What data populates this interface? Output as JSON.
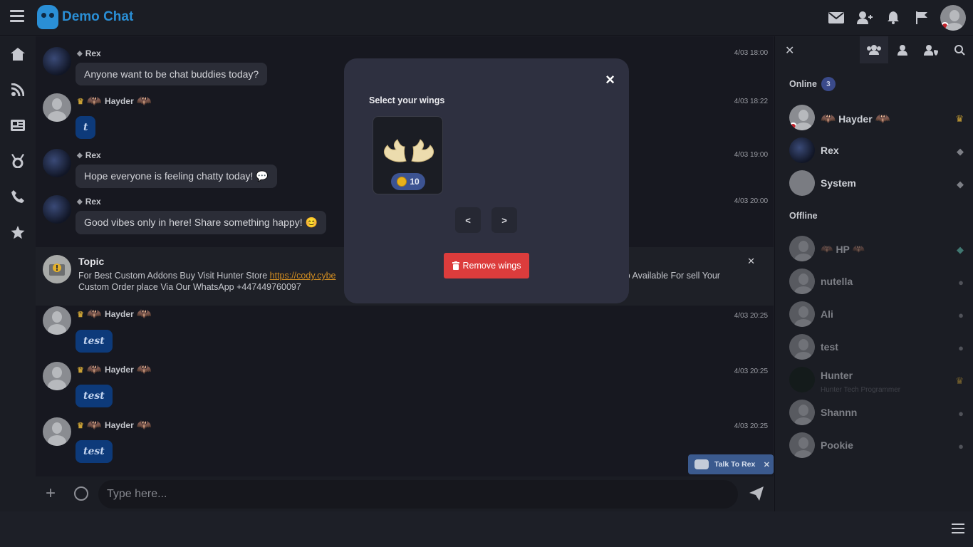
{
  "app": {
    "title": "Demo Chat"
  },
  "messages": [
    {
      "user": "Rex",
      "text": "Anyone want to be chat buddies today?",
      "time": "4/03 18:00"
    },
    {
      "user": "Hayder",
      "text": "t",
      "time": "4/03 18:22"
    },
    {
      "user": "Rex",
      "text": "Hope everyone is feeling chatty today! 💬",
      "time": "4/03 19:00"
    },
    {
      "user": "Rex",
      "text": "Good vibes only in here! Share something happy! 😊",
      "time": "4/03 20:00"
    },
    {
      "user": "Hayder",
      "text": "test",
      "time": "4/03 20:25"
    },
    {
      "user": "Hayder",
      "text": "test",
      "time": "4/03 20:25"
    },
    {
      "user": "Hayder",
      "text": "test",
      "time": "4/03 20:25"
    }
  ],
  "topic": {
    "title": "Topic",
    "text_before": "For Best Custom Addons Buy Visit Hunter Store ",
    "link": "https://cody.cybe",
    "text_after": "so Available For sell Your",
    "text_line2": "Custom Order place Via Our WhatsApp +447449760097"
  },
  "talk_rex": {
    "label": "Talk To Rex"
  },
  "input": {
    "placeholder": "Type here..."
  },
  "sidebar": {
    "online_label": "Online",
    "online_count": "3",
    "offline_label": "Offline",
    "online_users": [
      {
        "name": "Hayder"
      },
      {
        "name": "Rex"
      },
      {
        "name": "System"
      }
    ],
    "offline_users": [
      {
        "name": "HP"
      },
      {
        "name": "nutella"
      },
      {
        "name": "Ali"
      },
      {
        "name": "test"
      },
      {
        "name": "Hunter",
        "sub": "Hunter Tech Programmer"
      },
      {
        "name": "Shannn"
      },
      {
        "name": "Pookie"
      }
    ]
  },
  "modal": {
    "title": "Select your wings",
    "close": "×",
    "price": "10",
    "prev": "<",
    "next": ">",
    "remove_label": "Remove wings"
  },
  "colors": {
    "brand": "#2a8fd6",
    "danger": "#dc3c3c",
    "bubble_blue": "#0d3a7a"
  }
}
